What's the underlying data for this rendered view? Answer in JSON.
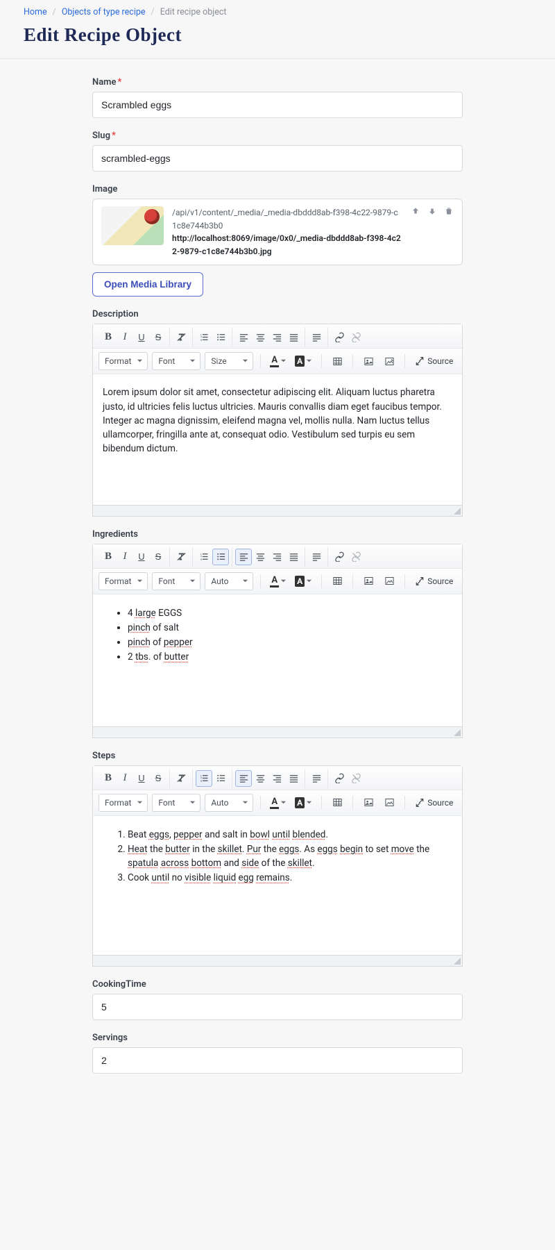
{
  "breadcrumb": {
    "home": "Home",
    "parent": "Objects of type recipe",
    "current": "Edit recipe object"
  },
  "page": {
    "title": "Edit Recipe Object"
  },
  "fields": {
    "name": {
      "label": "Name",
      "value": "Scrambled eggs"
    },
    "slug": {
      "label": "Slug",
      "value": "scrambled-eggs"
    },
    "image": {
      "label": "Image",
      "path": "/api/v1/content/_media/_media-dbddd8ab-f398-4c22-9879-c1c8e744b3b0",
      "url": "http://localhost:8069/image/0x0/_media-dbddd8ab-f398-4c22-9879-c1c8e744b3b0.jpg",
      "open_btn": "Open Media Library"
    },
    "description": {
      "label": "Description",
      "text": "Lorem ipsum dolor sit amet, consectetur adipiscing elit. Aliquam luctus pharetra justo, id ultricies felis luctus ultricies. Mauris convallis diam eget faucibus tempor. Integer ac magna dignissim, eleifend magna vel, mollis nulla. Nam luctus tellus ullamcorper, fringilla ante at, consequat odio. Vestibulum sed turpis eu sem bibendum dictum."
    },
    "ingredients": {
      "label": "Ingredients"
    },
    "steps": {
      "label": "Steps"
    },
    "cookingTime": {
      "label": "CookingTime",
      "value": "5"
    },
    "servings": {
      "label": "Servings",
      "value": "2"
    }
  },
  "toolbar": {
    "format": "Format",
    "font": "Font",
    "size": "Size",
    "auto": "Auto",
    "source": "Source"
  }
}
